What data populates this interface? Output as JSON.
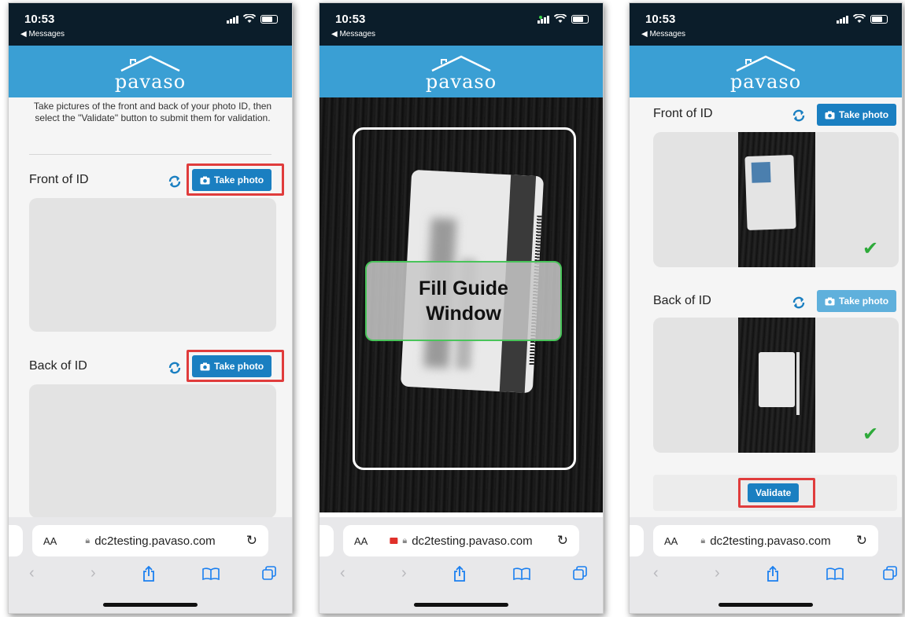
{
  "status": {
    "time": "10:53",
    "back_label": "◀ Messages"
  },
  "app": {
    "logo_text": "pavaso",
    "accent_color": "#3a9fd4",
    "button_color": "#1a7fc1"
  },
  "screen1": {
    "instructions": "Take pictures of the front and back of your photo ID, then select the \"Validate\" button to submit them for validation.",
    "front_label": "Front of ID",
    "back_label": "Back of ID",
    "take_photo_label": "Take photo"
  },
  "screen2": {
    "guide_text": "Fill Guide\nWindow"
  },
  "screen3": {
    "front_label": "Front of ID",
    "back_label": "Back of ID",
    "take_photo_label": "Take photo",
    "validate_label": "Validate"
  },
  "browser": {
    "aa_label": "AA",
    "url": "dc2testing.pavaso.com"
  },
  "icons": {
    "refresh": "refresh-icon",
    "camera": "camera-icon",
    "lock": "lock-icon",
    "share": "share-icon",
    "bookmarks": "book-icon",
    "tabs": "tabs-icon",
    "check": "checkmark-icon"
  }
}
